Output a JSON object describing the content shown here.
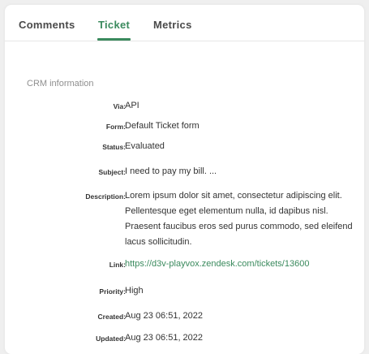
{
  "tabs": [
    {
      "label": "Comments",
      "active": false
    },
    {
      "label": "Ticket",
      "active": true
    },
    {
      "label": "Metrics",
      "active": false
    }
  ],
  "section_title": "CRM information",
  "fields": {
    "via": {
      "label": "Via:",
      "value": "API"
    },
    "form": {
      "label": "Form:",
      "value": "Default Ticket form"
    },
    "status": {
      "label": "Status:",
      "value": "Evaluated"
    },
    "subject": {
      "label": "Subject:",
      "value": "I need to pay my bill. ..."
    },
    "description": {
      "label": "Description:",
      "value": "Lorem ipsum dolor sit amet, consectetur adipiscing elit. Pellentesque eget elementum nulla, id dapibus nisl. Praesent faucibus eros sed purus commodo, sed eleifend lacus sollicitudin."
    },
    "link": {
      "label": "Link:",
      "value": "https://d3v-playvox.zendesk.com/tickets/13600"
    },
    "priority": {
      "label": "Priority:",
      "value": "High"
    },
    "created": {
      "label": "Created:",
      "value": "Aug 23 06:51, 2022"
    },
    "updated": {
      "label": "Updated:",
      "value": "Aug 23 06:51, 2022"
    }
  },
  "colors": {
    "accent": "#3a8a5d",
    "label_muted": "#8f8f8f",
    "text": "#333333"
  }
}
